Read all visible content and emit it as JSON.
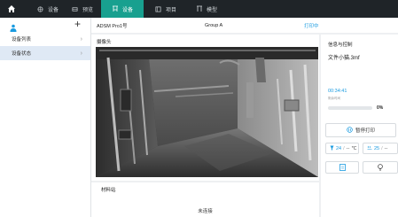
{
  "topbar": {
    "tabs": [
      {
        "label": "设备",
        "icon": "globe-icon"
      },
      {
        "label": "预览",
        "icon": "layers-icon"
      },
      {
        "label": "设备",
        "icon": "printer-icon",
        "active": true
      },
      {
        "label": "项目",
        "icon": "project-icon"
      },
      {
        "label": "模型",
        "icon": "model-icon"
      }
    ],
    "active_color": "#18a08f",
    "background": "#1f2428"
  },
  "sidebar": {
    "items": [
      {
        "label": "设备列表",
        "active": false
      },
      {
        "label": "设备状态",
        "active": true
      }
    ]
  },
  "status": {
    "device": "ADSM Pro1号",
    "group": "Group A",
    "state": "打印中",
    "state_color": "#1a9be0"
  },
  "camera": {
    "title": "摄像头"
  },
  "materials": {
    "title": "材料站",
    "empty": "未连接"
  },
  "print_info": {
    "title": "信息与控制",
    "file": "文件小猫.3mf",
    "time": "00:34:41",
    "time_label": "剩余时间",
    "progress": 0,
    "progress_text": "0%",
    "pause_label": "暂停打印",
    "nozzle_temp": "24",
    "nozzle_target": "--",
    "temp_unit": "℃",
    "bed_temp": "25",
    "bed_target": "--"
  }
}
